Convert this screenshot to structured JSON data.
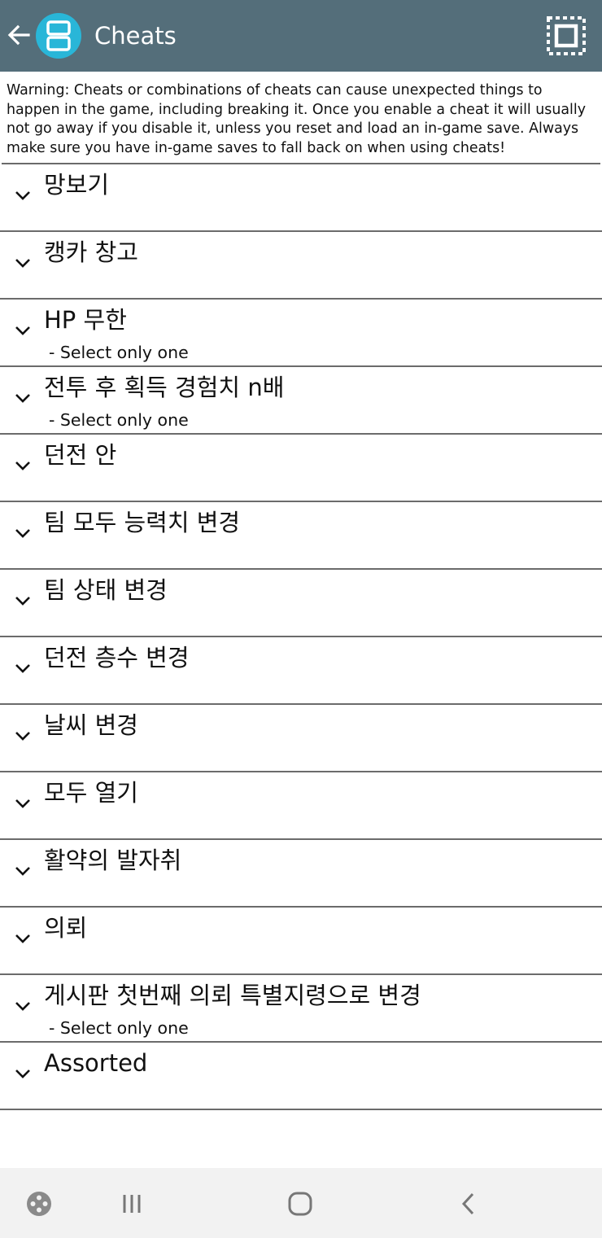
{
  "appbar": {
    "title": "Cheats",
    "back_icon": "arrow-left-icon",
    "logo_icon": "nintendo-ds-logo",
    "fullscreen_icon": "fullscreen-toggle-icon",
    "bg_color": "#546e7a",
    "logo_color": "#29b6d8"
  },
  "warning_text": "Warning: Cheats or combinations of cheats can cause unexpected things to happen in the game, including breaking it. Once you enable a cheat it will usually not go away if you disable it, unless you reset and load an in-game save. Always make sure you have in-game saves to fall back on when using cheats!",
  "cheats": [
    {
      "title": "망보기",
      "subtitle": ""
    },
    {
      "title": "캥카 창고",
      "subtitle": ""
    },
    {
      "title": "HP 무한",
      "subtitle": "- Select only one"
    },
    {
      "title": "전투 후 획득 경험치 n배",
      "subtitle": "- Select only one"
    },
    {
      "title": "던전 안",
      "subtitle": ""
    },
    {
      "title": "팀 모두 능력치 변경",
      "subtitle": ""
    },
    {
      "title": "팀 상태 변경",
      "subtitle": ""
    },
    {
      "title": "던전 층수 변경",
      "subtitle": ""
    },
    {
      "title": "날씨 변경",
      "subtitle": ""
    },
    {
      "title": "모두 열기",
      "subtitle": ""
    },
    {
      "title": "활약의 발자취",
      "subtitle": ""
    },
    {
      "title": "의뢰",
      "subtitle": ""
    },
    {
      "title": "게시판 첫번째 의뢰 특별지령으로 변경",
      "subtitle": "- Select only one"
    },
    {
      "title": "Assorted",
      "subtitle": ""
    }
  ],
  "navbar": {
    "icons": [
      "game-launcher-icon",
      "recent-apps-icon",
      "home-icon",
      "back-icon"
    ]
  }
}
